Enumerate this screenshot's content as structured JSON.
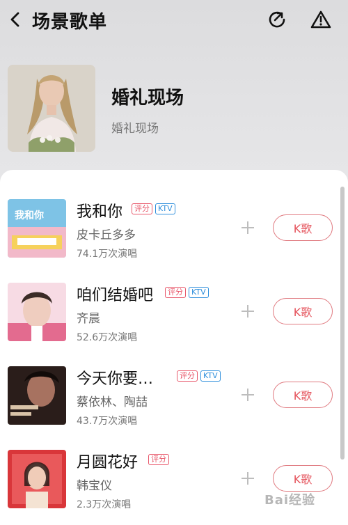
{
  "header": {
    "title": "场景歌单",
    "back_icon": "chevron-left-icon",
    "share_icon": "share-icon",
    "report_icon": "warning-icon"
  },
  "playlist": {
    "name": "婚礼现场",
    "subtitle": "婚礼现场"
  },
  "songs": [
    {
      "title": "我和你",
      "artist": "皮卡丘多多",
      "count": "74.1万次演唱",
      "tag_score": "评分",
      "tag_ktv": "KTV",
      "button": "K歌"
    },
    {
      "title": "咱们结婚吧",
      "artist": "齐晨",
      "count": "52.6万次演唱",
      "tag_score": "评分",
      "tag_ktv": "KTV",
      "button": "K歌"
    },
    {
      "title": "今天你要…",
      "artist": "蔡依林、陶喆",
      "count": "43.7万次演唱",
      "tag_score": "评分",
      "tag_ktv": "KTV",
      "button": "K歌"
    },
    {
      "title": "月圆花好",
      "artist": "韩宝仪",
      "count": "2.3万次演唱",
      "tag_score": "评分",
      "button": "K歌"
    }
  ],
  "watermark": "Bai经验",
  "colors": {
    "accent_red": "#e5555e",
    "ktv_blue": "#2f8fdc"
  }
}
